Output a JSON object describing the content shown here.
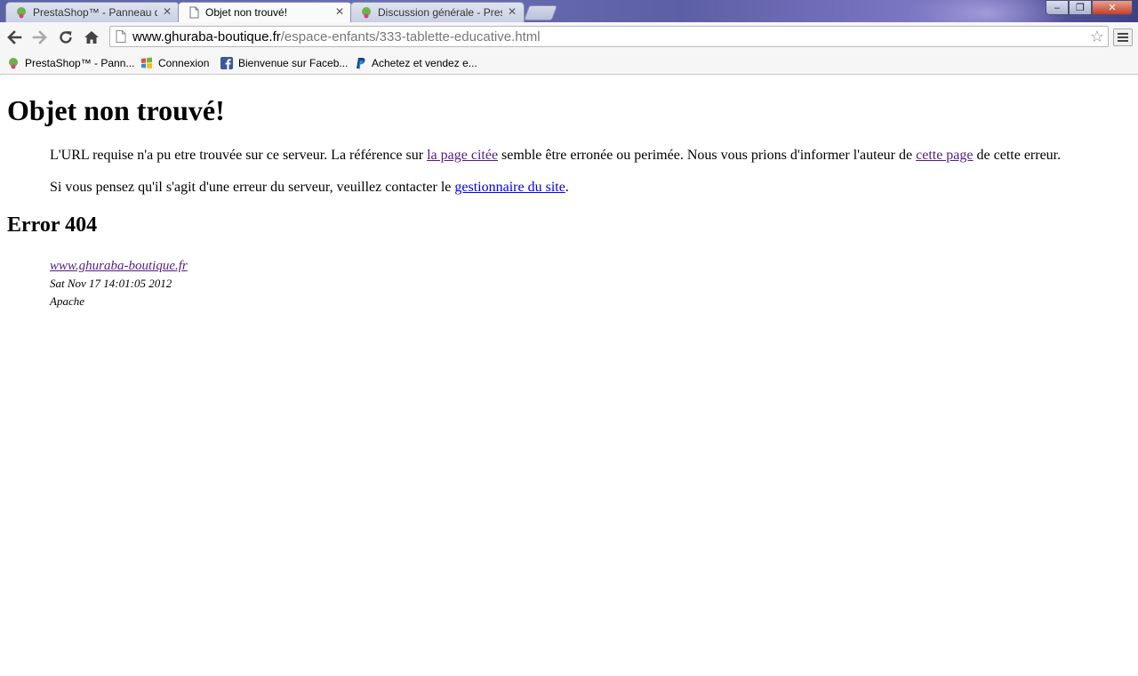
{
  "tabs": [
    {
      "title": "PrestaShop™ - Panneau d",
      "close": "✕",
      "favicon": "prestashop-icon"
    },
    {
      "title": "Objet non trouvé!",
      "close": "✕",
      "favicon": "page-icon"
    },
    {
      "title": "Discussion générale - Pres",
      "close": "✕",
      "favicon": "prestashop-icon"
    }
  ],
  "window": {
    "minimize": "‒",
    "restore": "❐",
    "close": "✕"
  },
  "omnibox": {
    "host": "www.ghuraba-boutique.fr",
    "path": "/espace-enfants/333-tablette-educative.html"
  },
  "bookmarks": [
    {
      "label": "PrestaShop™ - Pann...",
      "icon": "prestashop-icon"
    },
    {
      "label": "Connexion",
      "icon": "windows-flag-icon"
    },
    {
      "label": "Bienvenue sur Faceb...",
      "icon": "facebook-icon"
    },
    {
      "label": "Achetez et vendez e...",
      "icon": "paypal-icon"
    }
  ],
  "page": {
    "title": "Objet non trouvé!",
    "para1": {
      "before": "L'URL requise n'a pu etre trouvée sur ce serveur. La référence sur ",
      "link1": "la page citée",
      "middle": " semble être erronée ou perimée. Nous vous prions d'informer l'auteur de ",
      "link2": "cette page",
      "after": " de cette erreur."
    },
    "para2": {
      "before": "Si vous pensez qu'il s'agit d'une erreur du serveur, veuillez contacter le ",
      "link": "gestionnaire du site",
      "after": "."
    },
    "error_code": "Error 404",
    "address": {
      "site": "www.ghuraba-boutique.fr",
      "date": "Sat Nov 17 14:01:05 2012",
      "server": "Apache"
    }
  }
}
